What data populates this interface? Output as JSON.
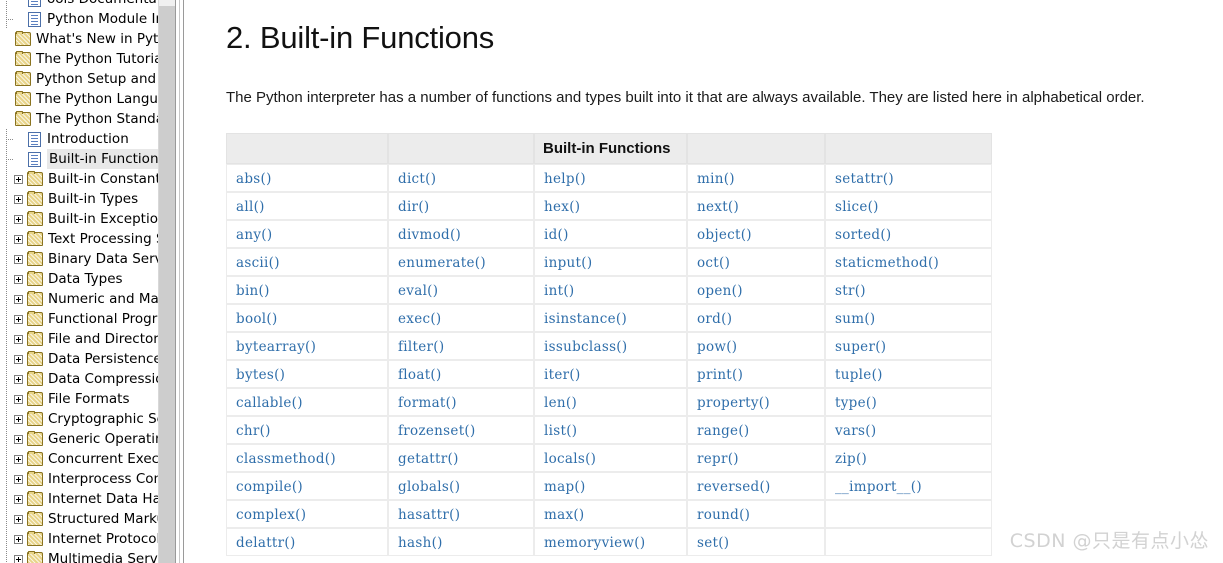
{
  "sidebar": {
    "items": [
      {
        "label": "ools Documentation",
        "icon": "page-icon",
        "level": 1,
        "expander": "none",
        "selected": false,
        "clipped_top": true
      },
      {
        "label": "Python Module Index",
        "icon": "page-icon",
        "level": 1,
        "expander": "none",
        "selected": false
      },
      {
        "label": "What's New in Python",
        "icon": "folder-icon",
        "level": 0,
        "expander": "none",
        "selected": false
      },
      {
        "label": "The Python Tutorial",
        "icon": "folder-icon",
        "level": 0,
        "expander": "none",
        "selected": false
      },
      {
        "label": "Python Setup and Usage",
        "icon": "folder-icon",
        "level": 0,
        "expander": "none",
        "selected": false
      },
      {
        "label": "The Python Language Re",
        "icon": "folder-icon",
        "level": 0,
        "expander": "none",
        "selected": false
      },
      {
        "label": "The Python Standard Lib",
        "icon": "folder-open-icon",
        "level": 0,
        "expander": "none",
        "selected": false
      },
      {
        "label": "Introduction",
        "icon": "page-icon",
        "level": 1,
        "expander": "none",
        "selected": false
      },
      {
        "label": "Built-in Functions",
        "icon": "page-icon",
        "level": 1,
        "expander": "none",
        "selected": true
      },
      {
        "label": "Built-in Constants",
        "icon": "folder-icon",
        "level": 1,
        "expander": "plus",
        "selected": false
      },
      {
        "label": "Built-in Types",
        "icon": "folder-icon",
        "level": 1,
        "expander": "plus",
        "selected": false
      },
      {
        "label": "Built-in Exceptions",
        "icon": "folder-icon",
        "level": 1,
        "expander": "plus",
        "selected": false
      },
      {
        "label": "Text Processing Serv",
        "icon": "folder-icon",
        "level": 1,
        "expander": "plus",
        "selected": false
      },
      {
        "label": "Binary Data Services",
        "icon": "folder-icon",
        "level": 1,
        "expander": "plus",
        "selected": false
      },
      {
        "label": "Data Types",
        "icon": "folder-icon",
        "level": 1,
        "expander": "plus",
        "selected": false
      },
      {
        "label": "Numeric and Mathem",
        "icon": "folder-icon",
        "level": 1,
        "expander": "plus",
        "selected": false
      },
      {
        "label": "Functional Programm",
        "icon": "folder-icon",
        "level": 1,
        "expander": "plus",
        "selected": false
      },
      {
        "label": "File and Directory Ac",
        "icon": "folder-icon",
        "level": 1,
        "expander": "plus",
        "selected": false
      },
      {
        "label": "Data Persistence",
        "icon": "folder-icon",
        "level": 1,
        "expander": "plus",
        "selected": false
      },
      {
        "label": "Data Compression a",
        "icon": "folder-icon",
        "level": 1,
        "expander": "plus",
        "selected": false
      },
      {
        "label": "File Formats",
        "icon": "folder-icon",
        "level": 1,
        "expander": "plus",
        "selected": false
      },
      {
        "label": "Cryptographic Servic",
        "icon": "folder-icon",
        "level": 1,
        "expander": "plus",
        "selected": false
      },
      {
        "label": "Generic Operating S",
        "icon": "folder-icon",
        "level": 1,
        "expander": "plus",
        "selected": false
      },
      {
        "label": "Concurrent Execution",
        "icon": "folder-icon",
        "level": 1,
        "expander": "plus",
        "selected": false
      },
      {
        "label": "Interprocess Commu",
        "icon": "folder-icon",
        "level": 1,
        "expander": "plus",
        "selected": false
      },
      {
        "label": "Internet Data Handli",
        "icon": "folder-icon",
        "level": 1,
        "expander": "plus",
        "selected": false
      },
      {
        "label": "Structured Markup P",
        "icon": "folder-icon",
        "level": 1,
        "expander": "plus",
        "selected": false
      },
      {
        "label": "Internet Protocols ar",
        "icon": "folder-icon",
        "level": 1,
        "expander": "plus",
        "selected": false
      },
      {
        "label": "Multimedia Services",
        "icon": "folder-icon",
        "level": 1,
        "expander": "plus",
        "selected": false
      }
    ]
  },
  "content": {
    "title": "2. Built-in Functions",
    "intro": "The Python interpreter has a number of functions and types built into it that are always available. They are listed here in alphabetical order.",
    "table": {
      "header": [
        "",
        "",
        "Built-in Functions",
        "",
        ""
      ],
      "columns": [
        [
          "abs()",
          "all()",
          "any()",
          "ascii()",
          "bin()",
          "bool()",
          "bytearray()",
          "bytes()",
          "callable()",
          "chr()",
          "classmethod()",
          "compile()",
          "complex()",
          "delattr()"
        ],
        [
          "dict()",
          "dir()",
          "divmod()",
          "enumerate()",
          "eval()",
          "exec()",
          "filter()",
          "float()",
          "format()",
          "frozenset()",
          "getattr()",
          "globals()",
          "hasattr()",
          "hash()"
        ],
        [
          "help()",
          "hex()",
          "id()",
          "input()",
          "int()",
          "isinstance()",
          "issubclass()",
          "iter()",
          "len()",
          "list()",
          "locals()",
          "map()",
          "max()",
          "memoryview()"
        ],
        [
          "min()",
          "next()",
          "object()",
          "oct()",
          "open()",
          "ord()",
          "pow()",
          "print()",
          "property()",
          "range()",
          "repr()",
          "reversed()",
          "round()",
          "set()"
        ],
        [
          "setattr()",
          "slice()",
          "sorted()",
          "staticmethod()",
          "str()",
          "sum()",
          "super()",
          "tuple()",
          "type()",
          "vars()",
          "zip()",
          "__import__()",
          "",
          ""
        ]
      ]
    }
  },
  "watermark": {
    "text": "CSDN @只是有点小怂"
  },
  "colors": {
    "link": "#2f6eaa",
    "header_bg": "#ececec",
    "cell_border": "#ececec",
    "selected_bg": "#e8e8e8",
    "scrollbar_thumb": "#cdcdcd",
    "watermark": "#d2d2d2"
  }
}
